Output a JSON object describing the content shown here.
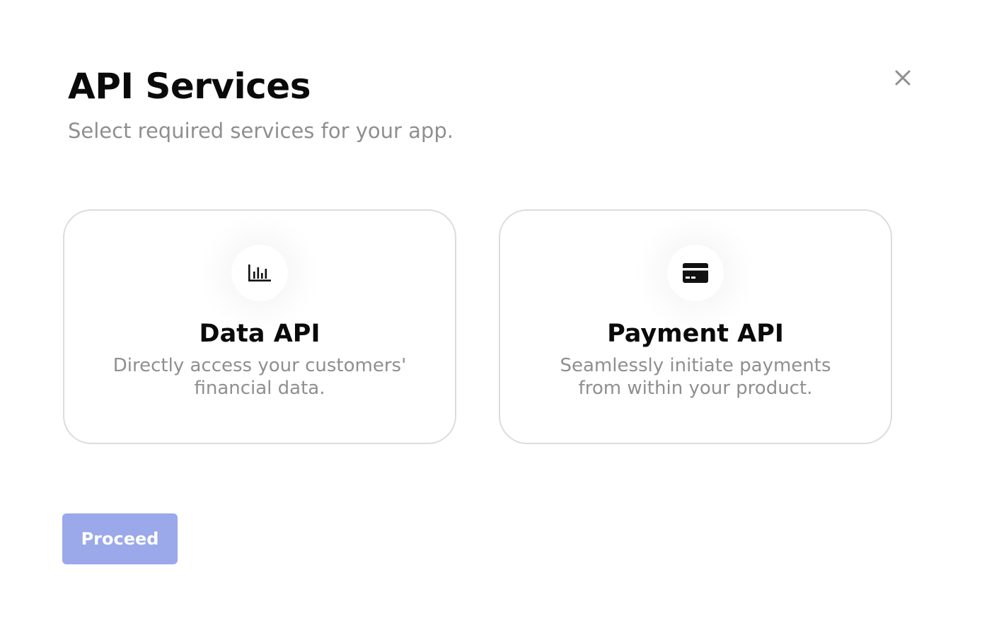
{
  "header": {
    "title": "API Services",
    "subtitle": "Select required services for your app."
  },
  "close": {
    "icon": "close-icon"
  },
  "services": [
    {
      "icon": "bar-chart-icon",
      "title": "Data API",
      "description": "Directly access your customers' financial data."
    },
    {
      "icon": "credit-card-icon",
      "title": "Payment API",
      "description": "Seamlessly initiate payments from within your product."
    }
  ],
  "footer": {
    "proceed_label": "Proceed"
  },
  "colors": {
    "primary_disabled": "#9ba8e9",
    "text_primary": "#0a0a0a",
    "text_secondary": "#8f8f8f",
    "card_border": "#dcdcdc"
  }
}
